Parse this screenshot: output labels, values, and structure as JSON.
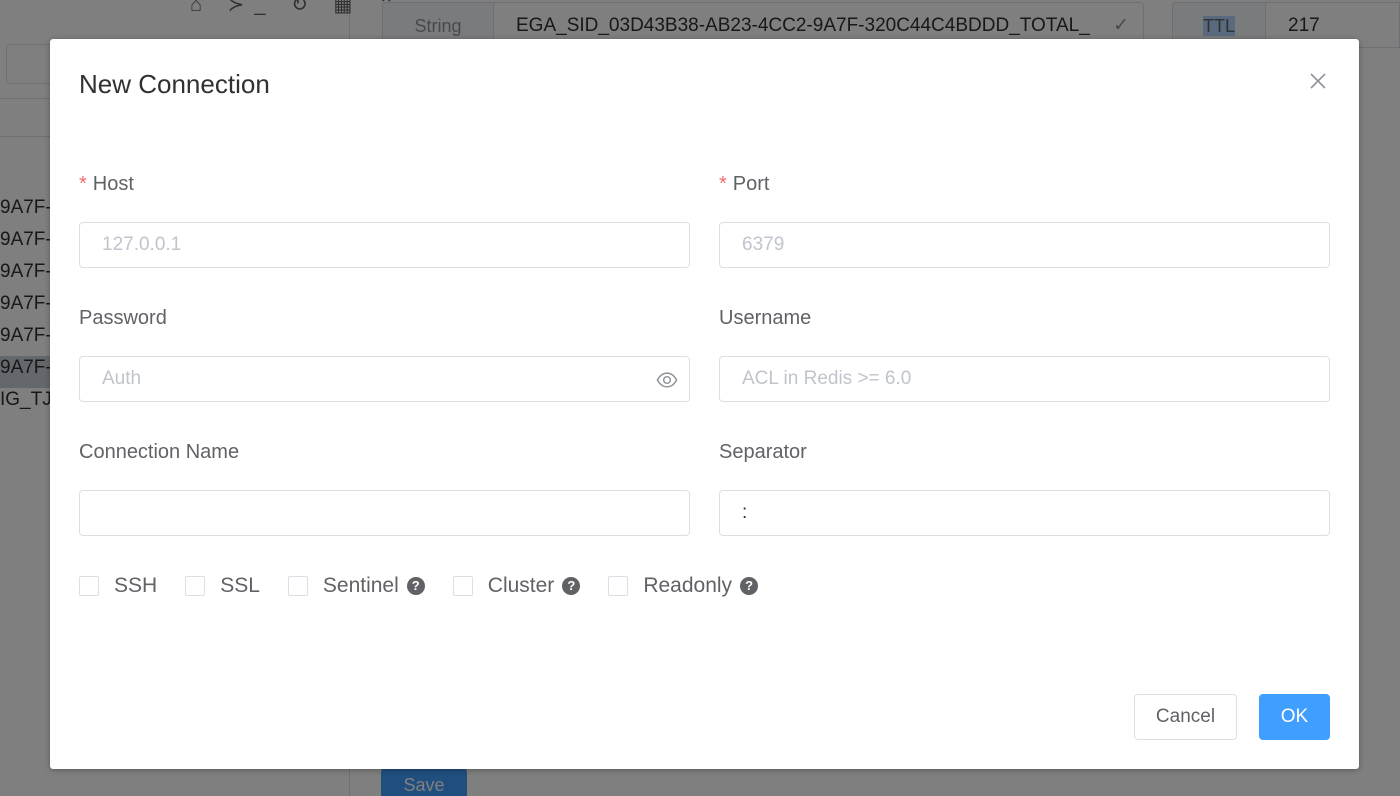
{
  "background": {
    "toolbar_icons": "⌂ ≻_ ↻ ▦ ⌃",
    "keys": [
      "9A7F-",
      "9A7F-",
      "9A7F-",
      "9A7F-",
      "9A7F-",
      "9A7F-",
      "IG_TJ"
    ],
    "type_label": "String",
    "key_name": "EGA_SID_03D43B38-AB23-4CC2-9A7F-320C44C4BDDD_TOTAL_",
    "key_confirm_icon": "✓",
    "ttl_label": "TTL",
    "ttl_value": "217",
    "save_label": "Save"
  },
  "dialog": {
    "title": "New Connection",
    "close_icon": "close-icon",
    "host": {
      "label": "Host",
      "required_mark": "*",
      "placeholder": "127.0.0.1",
      "value": ""
    },
    "port": {
      "label": "Port",
      "required_mark": "*",
      "placeholder": "6379",
      "value": ""
    },
    "password": {
      "label": "Password",
      "placeholder": "Auth",
      "value": ""
    },
    "username": {
      "label": "Username",
      "placeholder": "ACL in Redis >= 6.0",
      "value": ""
    },
    "connection_name": {
      "label": "Connection Name",
      "placeholder": "",
      "value": ""
    },
    "separator": {
      "label": "Separator",
      "placeholder": "",
      "value": ":"
    },
    "options": {
      "ssh": {
        "label": "SSH"
      },
      "ssl": {
        "label": "SSL"
      },
      "sentinel": {
        "label": "Sentinel",
        "help": "?"
      },
      "cluster": {
        "label": "Cluster",
        "help": "?"
      },
      "readonly": {
        "label": "Readonly",
        "help": "?"
      }
    },
    "cancel_label": "Cancel",
    "ok_label": "OK"
  },
  "colors": {
    "primary": "#409eff",
    "required": "#f56c6c",
    "border": "#dcdfe6",
    "overlay": "rgba(0,0,0,0.5)"
  }
}
